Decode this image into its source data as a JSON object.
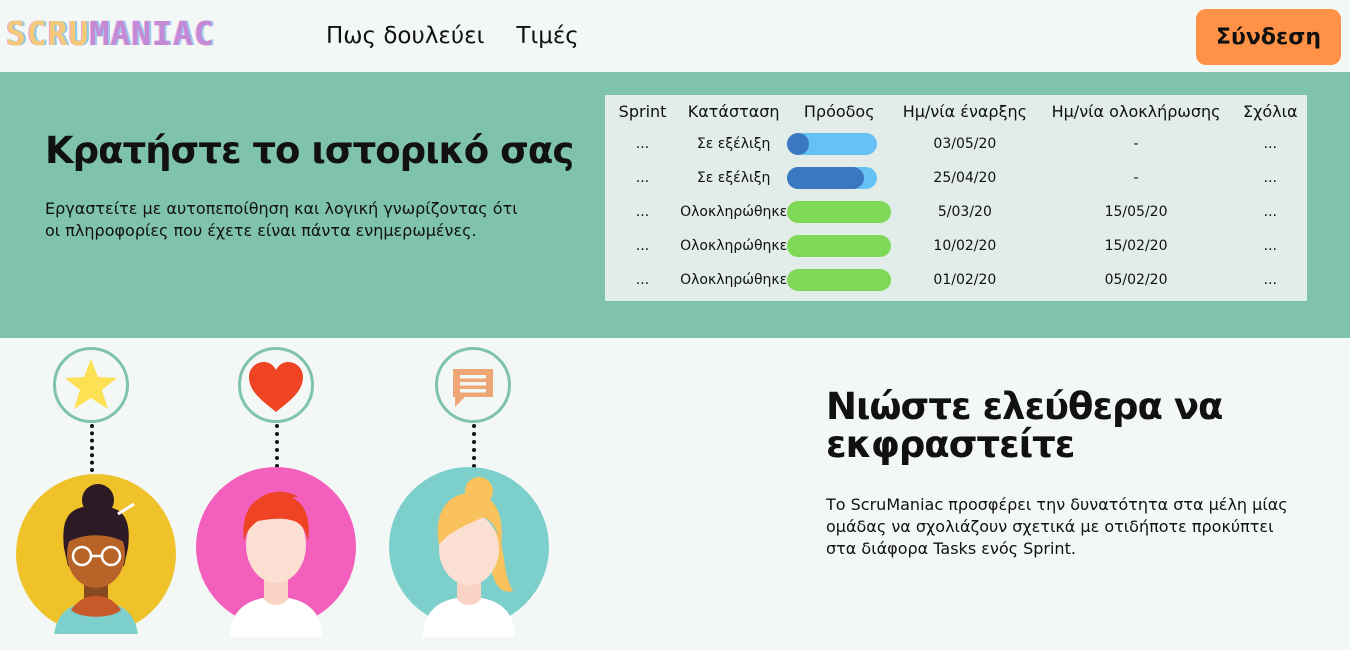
{
  "header": {
    "logo_part1": "SCRU",
    "logo_part2": "MANIAC",
    "nav": [
      "Πως δουλεύει",
      "Τιμές"
    ],
    "login_label": "Σύνδεση"
  },
  "hero": {
    "title": "Κρατήστε το ιστορικό σας",
    "text": "Εργαστείτε με αυτοπεποίθηση και λογική γνωρίζοντας ότι οι πληροφορίες που έχετε είναι πάντα ενημερωμένες."
  },
  "history_table": {
    "headers": [
      "Sprint",
      "Κατάσταση",
      "Πρόοδος",
      "Ημ/νία έναρξης",
      "Ημ/νία ολοκλήρωσης",
      "Σχόλια"
    ],
    "rows": [
      {
        "sprint": "...",
        "status": "Σε εξέλιξη",
        "progress": 0.15,
        "start": "03/05/20",
        "end": "-",
        "comments": "..."
      },
      {
        "sprint": "...",
        "status": "Σε εξέλιξη",
        "progress": 0.85,
        "start": "25/04/20",
        "end": "-",
        "comments": "..."
      },
      {
        "sprint": "...",
        "status": "Ολοκληρώθηκε",
        "progress": 1.0,
        "start": "5/03/20",
        "end": "15/05/20",
        "comments": "..."
      },
      {
        "sprint": "...",
        "status": "Ολοκληρώθηκε",
        "progress": 1.0,
        "start": "10/02/20",
        "end": "15/02/20",
        "comments": "..."
      },
      {
        "sprint": "...",
        "status": "Ολοκληρώθηκε",
        "progress": 1.0,
        "start": "01/02/20",
        "end": "05/02/20",
        "comments": "..."
      }
    ]
  },
  "feature": {
    "title": "Νιώστε ελεύθερα να εκφραστείτε",
    "text": "Το ScruManiac προσφέρει την δυνατότητα στα μέλη μίας ομάδας να σχολιάζουν σχετικά με οτιδήποτε προκύπτει στα διάφορα Tasks ενός Sprint."
  },
  "illustration": {
    "icons": [
      "star-icon",
      "heart-icon",
      "chat-icon"
    ],
    "avatars": [
      "woman-glasses-avatar",
      "red-hair-man-avatar",
      "blonde-woman-avatar"
    ]
  },
  "colors": {
    "band": "#7fc3ad",
    "login_button": "#ff9247",
    "progress_in_progress": "#3c78c2",
    "progress_track": "#66c2f5",
    "progress_done": "#7ed957"
  }
}
